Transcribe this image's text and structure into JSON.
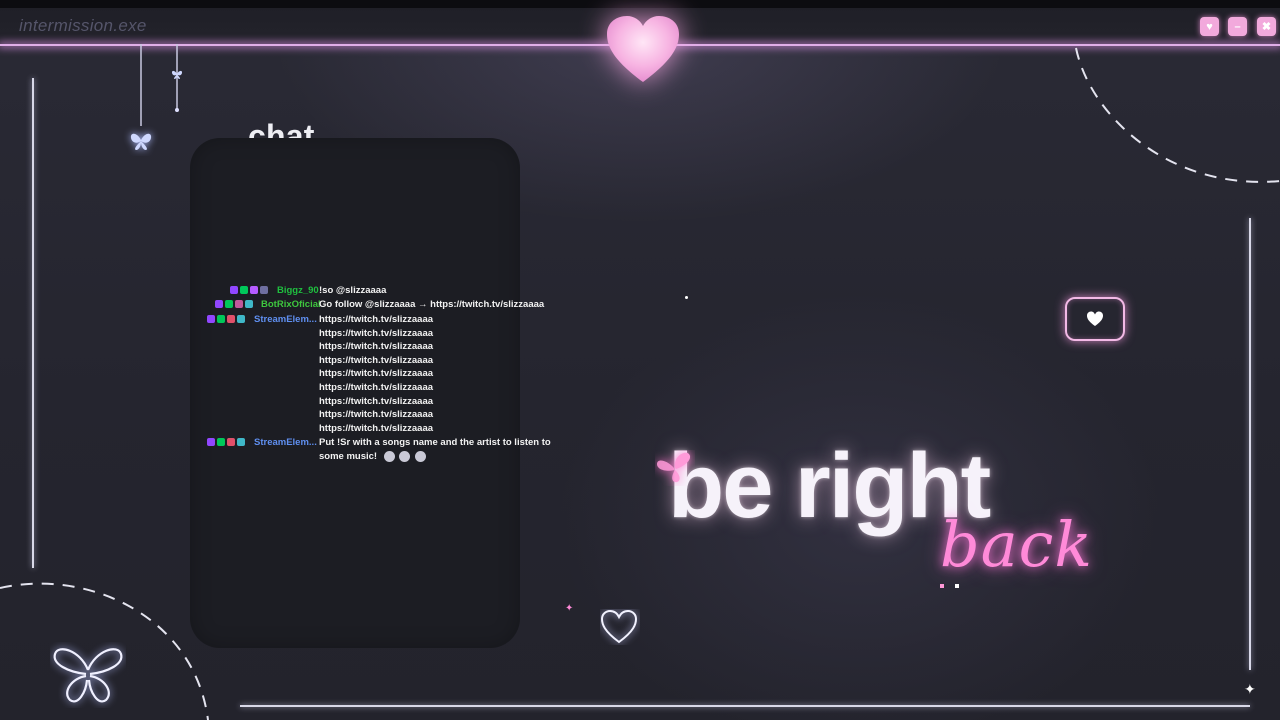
{
  "window": {
    "title": "intermission.exe",
    "buttons": [
      {
        "name": "heart",
        "glyph": "♥"
      },
      {
        "name": "minimize",
        "glyph": "–"
      },
      {
        "name": "close",
        "glyph": "✖"
      }
    ]
  },
  "chat": {
    "title": "chat",
    "messages": [
      {
        "user": "Biggz_90",
        "user_color": "#1fbf3f",
        "text": "!so @slizzaaaa"
      },
      {
        "user": "BotRixOficial",
        "user_color": "#3ec73e",
        "text": "Go follow @slizzaaaa → https://twitch.tv/slizzaaaa"
      },
      {
        "user": "StreamElem...",
        "user_color": "#5f8ff0",
        "text": "https://twitch.tv/slizzaaaa"
      },
      {
        "user": "",
        "user_color": "#5f8ff0",
        "text": "https://twitch.tv/slizzaaaa"
      },
      {
        "user": "",
        "user_color": "#5f8ff0",
        "text": "https://twitch.tv/slizzaaaa"
      },
      {
        "user": "",
        "user_color": "#5f8ff0",
        "text": "https://twitch.tv/slizzaaaa"
      },
      {
        "user": "",
        "user_color": "#5f8ff0",
        "text": "https://twitch.tv/slizzaaaa"
      },
      {
        "user": "",
        "user_color": "#5f8ff0",
        "text": "https://twitch.tv/slizzaaaa"
      },
      {
        "user": "",
        "user_color": "#5f8ff0",
        "text": "https://twitch.tv/slizzaaaa"
      },
      {
        "user": "",
        "user_color": "#5f8ff0",
        "text": "https://twitch.tv/slizzaaaa"
      },
      {
        "user": "",
        "user_color": "#5f8ff0",
        "text": "https://twitch.tv/slizzaaaa"
      },
      {
        "user": "StreamElem...",
        "user_color": "#5f8ff0",
        "text": "Put !Sr with a songs name and the artist to listen to"
      },
      {
        "user": "",
        "user_color": "#5f8ff0",
        "text": "some music!"
      }
    ]
  },
  "headline": {
    "main": "be right",
    "script": "back"
  },
  "colors": {
    "background": "#262630",
    "accent_pink": "#ff8ad8",
    "glow_line": "#e0aee8",
    "chat_panel": "#1c1d23"
  },
  "icons": [
    "heart-icon",
    "butterfly-icon",
    "chat-bubble-heart-icon",
    "sparkle-icon",
    "outline-heart-icon"
  ]
}
